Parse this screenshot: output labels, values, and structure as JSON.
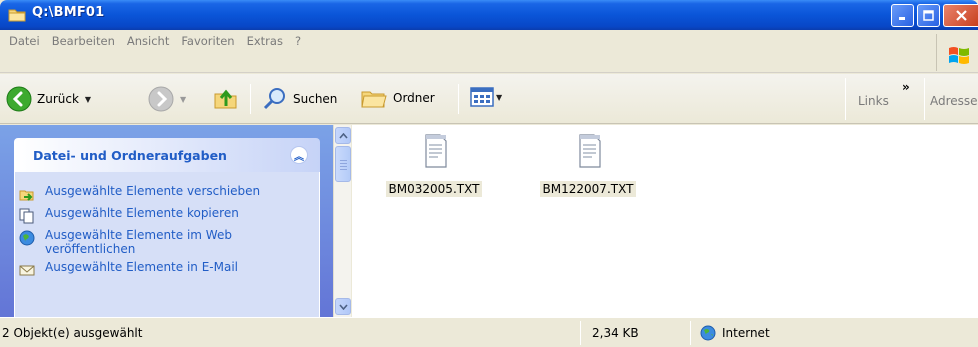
{
  "window": {
    "title": "Q:\\BMF01"
  },
  "menu": {
    "items": [
      "Datei",
      "Bearbeiten",
      "Ansicht",
      "Favoriten",
      "Extras",
      "?"
    ]
  },
  "toolbar": {
    "back_label": "Zurück",
    "search_label": "Suchen",
    "folders_label": "Ordner",
    "links_label": "Links",
    "chevron": "»",
    "address_label": "Adresse"
  },
  "taskpane": {
    "header": "Datei- und Ordneraufgaben",
    "items": [
      {
        "label": "Ausgewählte Elemente verschieben",
        "icon": "move-icon"
      },
      {
        "label": "Ausgewählte Elemente kopieren",
        "icon": "copy-icon"
      },
      {
        "label": "Ausgewählte Elemente im Web veröffentlichen",
        "icon": "publish-web-icon"
      },
      {
        "label": "Ausgewählte Elemente in E-Mail",
        "icon": "email-icon"
      }
    ]
  },
  "files": [
    {
      "name": "BM032005.TXT",
      "selected": true
    },
    {
      "name": "BM122007.TXT",
      "selected": true
    }
  ],
  "status": {
    "selection_text": "2 Objekt(e) ausgewählt",
    "size_text": "2,34 KB",
    "zone_text": "Internet"
  },
  "colors": {
    "titlebar": "#0A55D8",
    "taskpane_bg": "#7BA2E7",
    "taskpane_link": "#215DC6",
    "chrome": "#ECE9D8"
  }
}
